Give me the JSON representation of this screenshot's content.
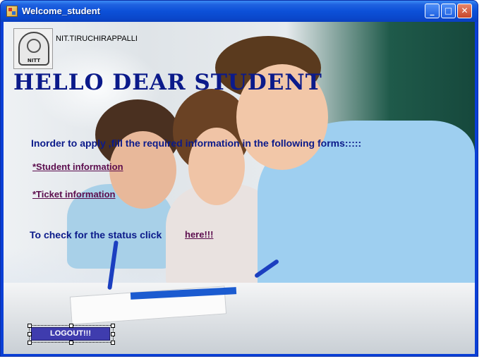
{
  "window": {
    "title": "Welcome_student",
    "controls": {
      "minimize": "_",
      "maximize": "□",
      "close": "✕"
    }
  },
  "header": {
    "logo_icon": "institute-seal-icon",
    "institute_name": "NIT.TIRUCHIRAPPALLI",
    "greeting": "HELLO DEAR STUDENT"
  },
  "main": {
    "instruction": "Inorder to apply ,fill the required information in the following forms:::::",
    "links": {
      "student_info": "*Student information",
      "ticket_info": "*Ticket information"
    },
    "status_prompt": "To check for the status click",
    "status_link": "here!!!"
  },
  "footer": {
    "logout_label": "LOGOUT!!!"
  },
  "colors": {
    "heading": "#0b1a8a",
    "link": "#5b0c4d",
    "logout_button": "#3f3cae",
    "titlebar": "#0c50d8"
  }
}
